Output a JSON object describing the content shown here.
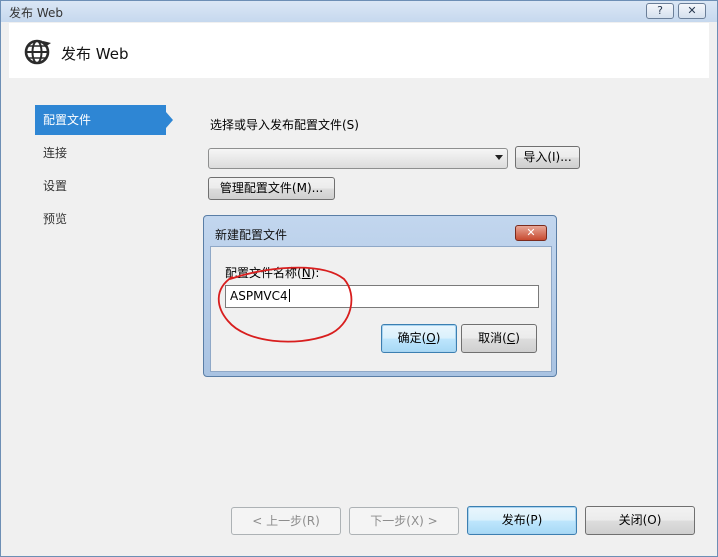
{
  "window": {
    "title": "发布 Web",
    "help_glyph": "?",
    "close_glyph": "✕"
  },
  "header": {
    "title": "发布 Web",
    "icon": "globe-icon"
  },
  "nav": {
    "items": [
      {
        "label": "配置文件",
        "selected": true
      },
      {
        "label": "连接",
        "selected": false
      },
      {
        "label": "设置",
        "selected": false
      },
      {
        "label": "预览",
        "selected": false
      }
    ]
  },
  "profile": {
    "select_label": "选择或导入发布配置文件(S)",
    "combo_value": "",
    "import_button": "导入(I)...",
    "manage_button": "管理配置文件(M)..."
  },
  "dialog": {
    "title": "新建配置文件",
    "close_glyph": "✕",
    "name_label_pre": "配置文件名称(",
    "name_label_key": "N",
    "name_label_post": "):",
    "name_value": "ASPMVC4",
    "ok_pre": "确定(",
    "ok_key": "O",
    "ok_post": ")",
    "cancel_pre": "取消(",
    "cancel_key": "C",
    "cancel_post": ")"
  },
  "footer": {
    "prev_button": "< 上一步(R)",
    "next_button": "下一步(X) >",
    "publish_button": "发布(P)",
    "close_button": "关闭(O)"
  },
  "colors": {
    "nav_selected": "#2e86d4",
    "annotation": "#d81e1e"
  }
}
